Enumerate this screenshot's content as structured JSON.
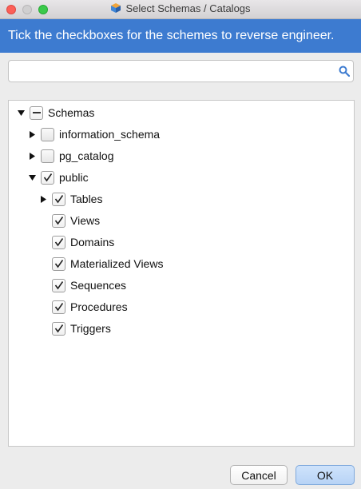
{
  "window": {
    "title": "Select Schemas / Catalogs"
  },
  "banner": {
    "text": "Tick the checkboxes for the schemes to reverse engineer."
  },
  "search": {
    "value": "",
    "placeholder": ""
  },
  "tree": {
    "schemas": {
      "label": "Schemas",
      "state": "indeterminate",
      "expanded": true
    },
    "information_schema": {
      "label": "information_schema",
      "state": "unchecked",
      "expanded": false
    },
    "pg_catalog": {
      "label": "pg_catalog",
      "state": "unchecked",
      "expanded": false
    },
    "public": {
      "label": "public",
      "state": "checked",
      "expanded": true
    },
    "tables": {
      "label": "Tables",
      "state": "checked",
      "expanded": false
    },
    "views": {
      "label": "Views",
      "state": "checked"
    },
    "domains": {
      "label": "Domains",
      "state": "checked"
    },
    "materialized_views": {
      "label": "Materialized Views",
      "state": "checked"
    },
    "sequences": {
      "label": "Sequences",
      "state": "checked"
    },
    "procedures": {
      "label": "Procedures",
      "state": "checked"
    },
    "triggers": {
      "label": "Triggers",
      "state": "checked"
    }
  },
  "buttons": {
    "cancel": "Cancel",
    "ok": "OK"
  },
  "colors": {
    "banner": "#3d7bd0",
    "ok_button": "#b7d3f6"
  }
}
